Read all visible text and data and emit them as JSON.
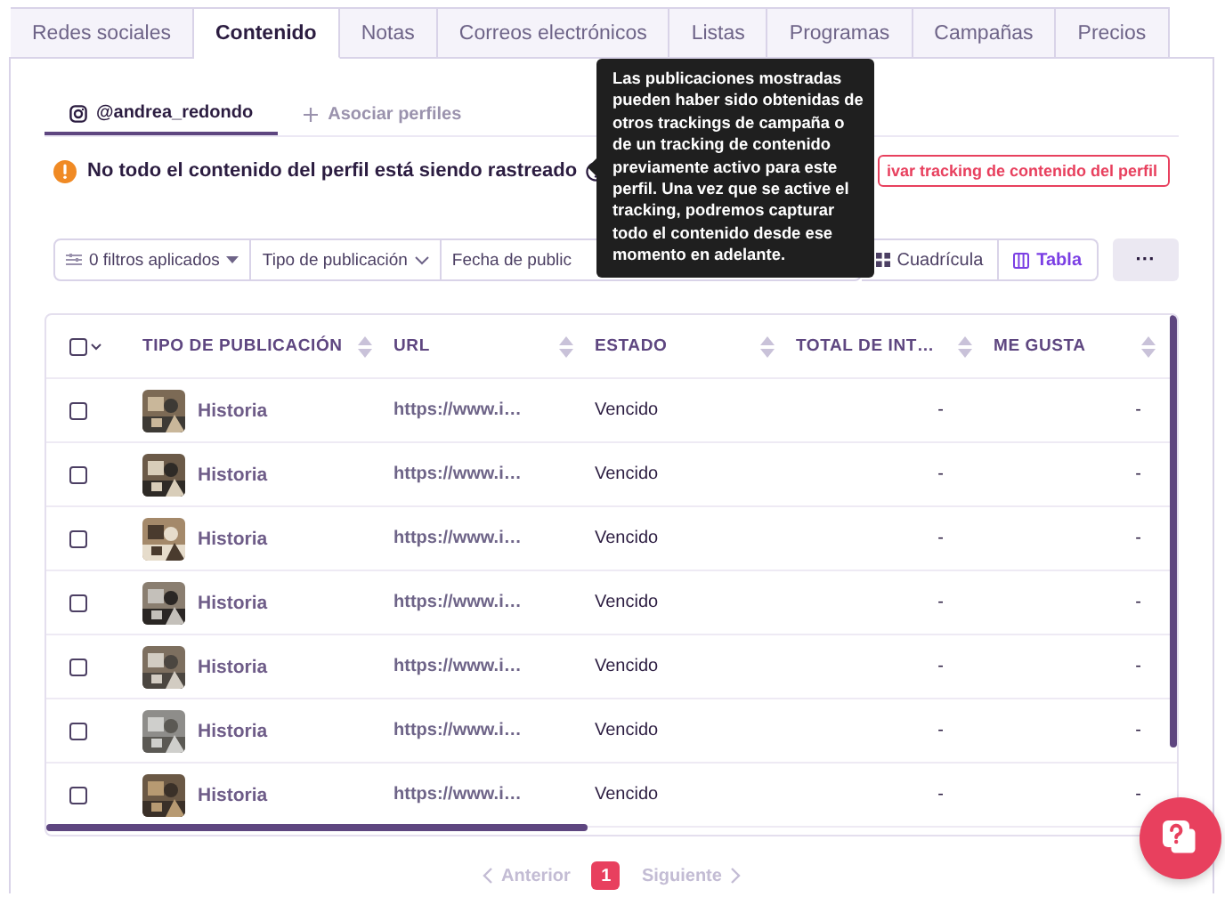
{
  "tabs": [
    {
      "label": "Redes sociales",
      "selected": false
    },
    {
      "label": "Contenido",
      "selected": true
    },
    {
      "label": "Notas",
      "selected": false
    },
    {
      "label": "Correos electrónicos",
      "selected": false
    },
    {
      "label": "Listas",
      "selected": false
    },
    {
      "label": "Programas",
      "selected": false
    },
    {
      "label": "Campañas",
      "selected": false
    },
    {
      "label": "Precios",
      "selected": false
    }
  ],
  "profile_tabs": [
    {
      "kind": "profile",
      "label": "@andrea_redondo",
      "selected": true
    },
    {
      "kind": "add",
      "label": "Asociar perfiles",
      "selected": false
    }
  ],
  "warning": {
    "text": "No todo el contenido del perfil está siendo rastreado",
    "button": "ivar tracking de contenido del perfil"
  },
  "tooltip": {
    "text": "Las publicaciones mostradas pueden haber sido obtenidas de otros trackings de campaña o de un tracking de contenido previamente activo para este perfil. Una vez que se active el tracking, podremos capturar todo el contenido desde ese momento en adelante."
  },
  "filters": [
    {
      "label": "0 filtros aplicados",
      "kind": "count"
    },
    {
      "label": "Tipo de publicación",
      "kind": "dropdown"
    },
    {
      "label": "Fecha de public",
      "kind": "plain"
    }
  ],
  "views": [
    {
      "label": "Cuadrícula",
      "kind": "grid",
      "selected": false
    },
    {
      "label": "Tabla",
      "kind": "table",
      "selected": true
    }
  ],
  "more_button": "···",
  "table": {
    "select_all": {
      "checked": false
    },
    "columns": [
      "TIPO DE PUBLICACIÓN",
      "URL",
      "ESTADO",
      "TOTAL DE INT…",
      "ME GUSTA"
    ],
    "rows": [
      {
        "checked": false,
        "type": "Historia",
        "url": "https://www.i…",
        "status": "Vencido",
        "total": "-",
        "likes": "-"
      },
      {
        "checked": false,
        "type": "Historia",
        "url": "https://www.i…",
        "status": "Vencido",
        "total": "-",
        "likes": "-"
      },
      {
        "checked": false,
        "type": "Historia",
        "url": "https://www.i…",
        "status": "Vencido",
        "total": "-",
        "likes": "-"
      },
      {
        "checked": false,
        "type": "Historia",
        "url": "https://www.i…",
        "status": "Vencido",
        "total": "-",
        "likes": "-"
      },
      {
        "checked": false,
        "type": "Historia",
        "url": "https://www.i…",
        "status": "Vencido",
        "total": "-",
        "likes": "-"
      },
      {
        "checked": false,
        "type": "Historia",
        "url": "https://www.i…",
        "status": "Vencido",
        "total": "-",
        "likes": "-"
      },
      {
        "checked": false,
        "type": "Historia",
        "url": "https://www.i…",
        "status": "Vencido",
        "total": "-",
        "likes": "-"
      }
    ]
  },
  "pagination": {
    "previous": {
      "label": "Anterior",
      "disabled": true
    },
    "pages": [
      {
        "label": "1",
        "selected": true
      }
    ],
    "next": {
      "label": "Siguiente",
      "disabled": true
    }
  }
}
